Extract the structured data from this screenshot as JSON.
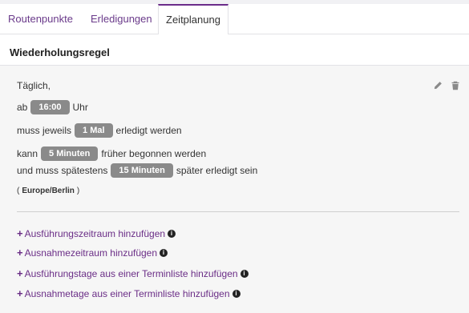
{
  "tabs": [
    {
      "label": "Routenpunkte"
    },
    {
      "label": "Erledigungen"
    },
    {
      "label": "Zeitplanung"
    }
  ],
  "section": {
    "title": "Wiederholungsregel"
  },
  "rule": {
    "frequency": "Täglich,",
    "time_prefix": "ab",
    "time_value": "16:00",
    "time_suffix": "Uhr",
    "count_prefix": "muss jeweils",
    "count_value": "1 Mal",
    "count_suffix": "erledigt werden",
    "early_prefix": "kann",
    "early_value": "5 Minuten",
    "early_suffix": "früher begonnen werden",
    "late_prefix": "und muss spätestens",
    "late_value": "15 Minuten",
    "late_suffix": "später erledigt sein",
    "timezone_open": "(",
    "timezone_value": "Europe/Berlin",
    "timezone_close": ")"
  },
  "links": [
    {
      "label": "Ausführungszeitraum hinzufügen"
    },
    {
      "label": "Ausnahmezeitraum hinzufügen"
    },
    {
      "label": "Ausführungstage aus einer Terminliste hinzufügen"
    },
    {
      "label": "Ausnahmetage aus einer Terminliste hinzufügen"
    }
  ],
  "icons": {
    "edit": "pencil-icon",
    "delete": "trash-icon",
    "add": "plus-icon",
    "info": "info-icon"
  },
  "colors": {
    "accent": "#6a2d86",
    "pill": "#8a8a8a",
    "panel": "#f6f6f6"
  }
}
